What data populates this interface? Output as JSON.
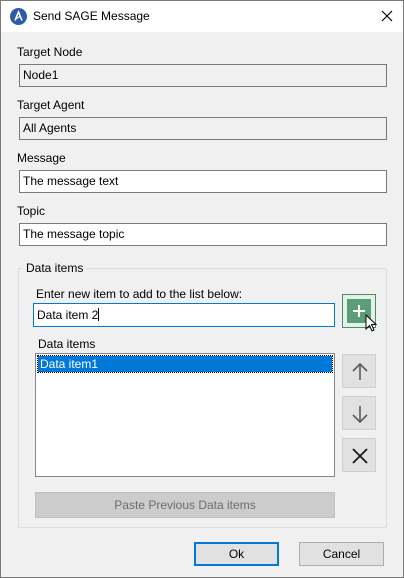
{
  "window": {
    "title": "Send SAGE Message",
    "icon": "sage-logo-icon"
  },
  "form": {
    "target_node": {
      "label": "Target Node",
      "value": "Node1"
    },
    "target_agent": {
      "label": "Target Agent",
      "value": "All Agents"
    },
    "message": {
      "label": "Message",
      "value": "The message text"
    },
    "topic": {
      "label": "Topic",
      "value": "The message topic"
    }
  },
  "data_items_group": {
    "legend": "Data items",
    "new_item_label": "Enter new item to add to the list below:",
    "new_item_value": "Data item 2",
    "list_label": "Data items",
    "items": [
      "Data item1"
    ],
    "selected_index": 0,
    "add_icon": "plus-icon",
    "move_up_icon": "arrow-up-icon",
    "move_down_icon": "arrow-down-icon",
    "remove_icon": "close-icon",
    "paste_label": "Paste Previous Data items"
  },
  "buttons": {
    "ok": "Ok",
    "cancel": "Cancel"
  },
  "colors": {
    "accent": "#0078d7",
    "add_button": "#5b9e76"
  }
}
